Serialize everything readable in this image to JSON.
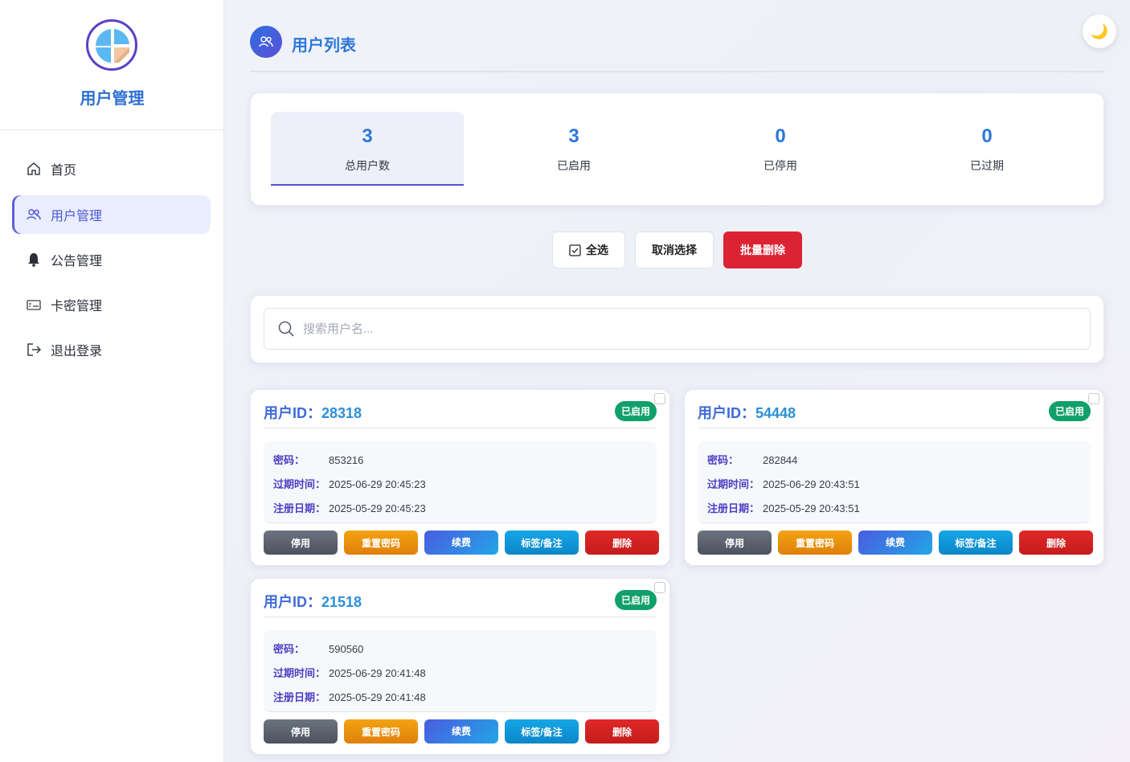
{
  "sidebar": {
    "brand": "用户管理",
    "items": [
      {
        "label": "首页",
        "icon": "home-icon"
      },
      {
        "label": "用户管理",
        "icon": "users-icon"
      },
      {
        "label": "公告管理",
        "icon": "bell-icon"
      },
      {
        "label": "卡密管理",
        "icon": "card-icon"
      },
      {
        "label": "退出登录",
        "icon": "logout-icon"
      }
    ]
  },
  "header": {
    "title": "用户列表",
    "theme_icon": "🌙"
  },
  "stats": [
    {
      "num": "3",
      "label": "总用户数"
    },
    {
      "num": "3",
      "label": "已启用"
    },
    {
      "num": "0",
      "label": "已停用"
    },
    {
      "num": "0",
      "label": "已过期"
    }
  ],
  "bulk": {
    "select_all": "全选",
    "deselect": "取消选择",
    "batch_delete": "批量删除"
  },
  "search": {
    "placeholder": "搜索用户名..."
  },
  "users": [
    {
      "id_label": "用户ID：",
      "id": "28318",
      "status": "已启用",
      "pwd_k": "密码：",
      "pwd": "853216",
      "exp_k": "过期时间：",
      "exp": "2025-06-29 20:45:23",
      "reg_k": "注册日期：",
      "reg": "2025-05-29 20:45:23"
    },
    {
      "id_label": "用户ID：",
      "id": "54448",
      "status": "已启用",
      "pwd_k": "密码：",
      "pwd": "282844",
      "exp_k": "过期时间：",
      "exp": "2025-06-29 20:43:51",
      "reg_k": "注册日期：",
      "reg": "2025-05-29 20:43:51"
    },
    {
      "id_label": "用户ID：",
      "id": "21518",
      "status": "已启用",
      "pwd_k": "密码：",
      "pwd": "590560",
      "exp_k": "过期时间：",
      "exp": "2025-06-29 20:41:48",
      "reg_k": "注册日期：",
      "reg": "2025-05-29 20:41:48"
    }
  ],
  "actions": {
    "disable": "停用",
    "reset": "重置密码",
    "renew": "续费",
    "tag": "标签/备注",
    "delete": "删除"
  },
  "colors": {
    "accent": "#2c78d8",
    "active_badge": "#11a06b",
    "danger": "#dc2334"
  }
}
